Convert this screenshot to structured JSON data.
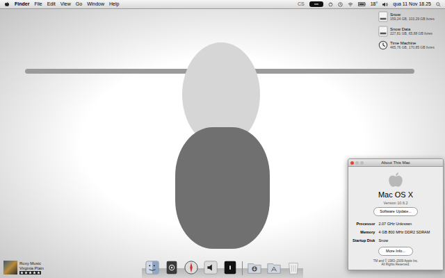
{
  "menu_bar": {
    "app": "Finder",
    "menus": [
      "File",
      "Edit",
      "View",
      "Go",
      "Window",
      "Help"
    ],
    "status_text": "CS",
    "temperature": "18°",
    "clock": "qua 11 Nov 18.25"
  },
  "desktop_icons": [
    {
      "name": "Snow",
      "detail": "159,24 GB, 103,29 GB livres"
    },
    {
      "name": "Snow Data",
      "detail": "227,81 GB, 65,88 GB livres"
    },
    {
      "name": "Time Machine",
      "detail": "465,76 GB, 170,85 GB livres"
    }
  ],
  "now_playing": {
    "artist": "Roxy Music",
    "title": "Virginia Plain",
    "stars": 5
  },
  "about_window": {
    "title": "About This Mac",
    "os_name": "Mac OS X",
    "version": "Version 10.6.2",
    "update_button": "Software Update...",
    "specs": [
      {
        "label": "Processor",
        "value": "2.07 GHz Unknown"
      },
      {
        "label": "Memory",
        "value": "4 GB 800 MHz DDR2 SDRAM"
      },
      {
        "label": "Startup Disk",
        "value": "Snow"
      }
    ],
    "more_button": "More Info...",
    "footer": [
      "TM and © 1983–2009 Apple Inc.",
      "All Rights Reserved."
    ]
  }
}
